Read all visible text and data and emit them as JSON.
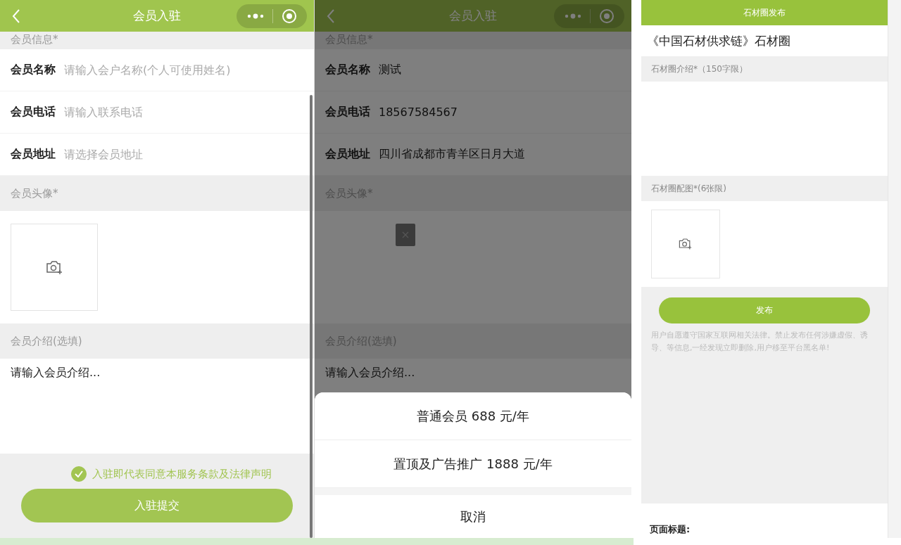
{
  "screens": [
    {
      "title": "会员入驻",
      "dimmed": false,
      "show_scrollbar": true,
      "info_header": "会员信息*",
      "fields": [
        {
          "label": "会员名称",
          "placeholder": "请输入会户名称(个人可使用姓名)"
        },
        {
          "label": "会员电话",
          "placeholder": "请输入联系电话"
        },
        {
          "label": "会员地址",
          "placeholder": "请选择会员地址"
        }
      ],
      "avatar_header": "会员头像*",
      "avatar": {
        "kind": "upload"
      },
      "intro_header": "会员介绍(选填)",
      "intro": {
        "placeholder": "请输入会员介绍..."
      },
      "agreement": {
        "checked": true,
        "text": "入驻即代表同意本服务条款及法律声明"
      },
      "submit": "入驻提交"
    },
    {
      "title": "会员入驻",
      "dimmed": true,
      "show_scrollbar": false,
      "info_header": "会员信息*",
      "fields": [
        {
          "label": "会员名称",
          "value": "测试"
        },
        {
          "label": "会员电话",
          "value": "18567584567"
        },
        {
          "label": "会员地址",
          "value": "四川省成都市青羊区日月大道"
        }
      ],
      "avatar_header": "会员头像*",
      "avatar": {
        "kind": "uploaded"
      },
      "intro_header": "会员介绍(选填)",
      "intro": {
        "placeholder": "请输入会员介绍..."
      },
      "action_sheet": {
        "options": [
          "普通会员 688 元/年",
          "置顶及广告推广 1888 元/年"
        ],
        "cancel": "取消"
      }
    }
  ],
  "publish": {
    "header": "石材圈发布",
    "title": "《中国石材供求链》石材圈",
    "intro_header": "石材圈介绍*（150字限）",
    "images_header": "石材圈配图*(6张限)",
    "button": "发布",
    "notice": "用户自愿遵守国家互联网相关法律。禁止发布任何涉嫌虚假、诱导、等信息,一经发现立即删除,用户移至平台黑名单!",
    "page_title_label": "页面标题:"
  }
}
